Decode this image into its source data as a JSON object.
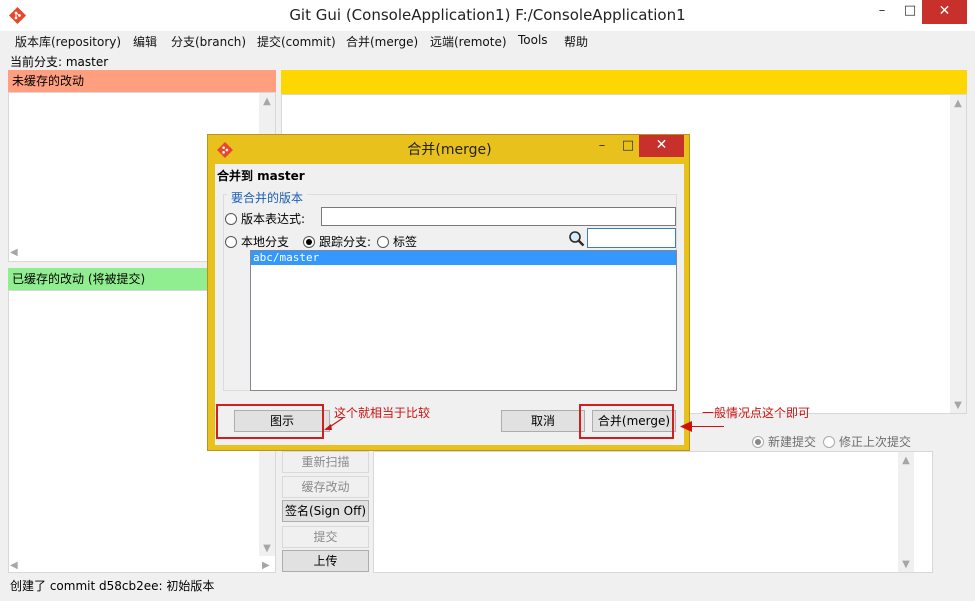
{
  "window": {
    "title": "Git Gui (ConsoleApplication1) F:/ConsoleApplication1",
    "minimize": "–",
    "maximize": "□",
    "close": "✕"
  },
  "menu": [
    "版本库(repository)",
    "编辑",
    "分支(branch)",
    "提交(commit)",
    "合并(merge)",
    "远端(remote)",
    "Tools",
    "帮助"
  ],
  "current_branch": "当前分支: master",
  "unstaged_header": "未缓存的改动",
  "staged_header": "已缓存的改动 (将被提交)",
  "commit_options": {
    "new_commit": "新建提交",
    "amend": "修正上次提交"
  },
  "action_buttons": {
    "rescan": "重新扫描",
    "stage": "缓存改动",
    "signoff": "签名(Sign Off)",
    "commit": "提交",
    "push": "上传"
  },
  "status_bar": "创建了 commit d58cb2ee: 初始版本",
  "dialog": {
    "title": "合并(merge)",
    "minimize": "–",
    "maximize": "□",
    "close": "✕",
    "target": "合并到 master",
    "group_label": "要合并的版本",
    "revision_expression": "版本表达式:",
    "local_branch": "本地分支",
    "tracking_branch": "跟踪分支:",
    "tag": "标签",
    "selected_radio": "tracking_branch",
    "list_items": [
      "abc/master"
    ],
    "visualize_button": "图示",
    "cancel_button": "取消",
    "merge_button": "合并(merge)"
  },
  "annotations": {
    "visualize_note": "这个就相当于比较",
    "merge_note": "一般情况点这个即可"
  },
  "colors": {
    "unstaged_header": "#ff9f7f",
    "staged_header": "#90ee90",
    "diff_header": "#ffd700",
    "dialog_frame": "#e9c11d",
    "selection": "#3399ff",
    "annotation": "#cc1111"
  },
  "icons": {
    "app": "git-logo-icon",
    "search": "magnifier-icon"
  }
}
